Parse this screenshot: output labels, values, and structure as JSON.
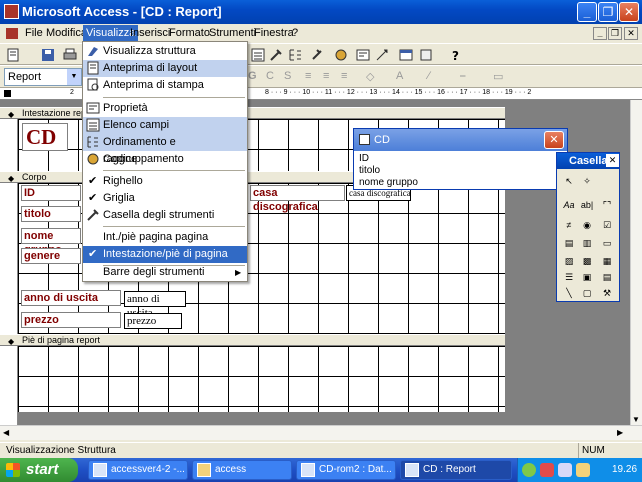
{
  "window": {
    "title": "Microsoft Access - [CD : Report]"
  },
  "menubar": {
    "items": [
      "File",
      "Modifica",
      "Visualizza",
      "Inserisci",
      "Formato",
      "Strumenti",
      "Finestra",
      "?"
    ],
    "active": "Visualizza"
  },
  "toolbar2": {
    "object_combo": "Report"
  },
  "view_menu": {
    "items": [
      {
        "label": "Visualizza struttura",
        "icon": "design-view-icon"
      },
      {
        "label": "Anteprima di layout",
        "icon": "layout-preview-icon"
      },
      {
        "label": "Anteprima di stampa",
        "icon": "print-preview-icon"
      },
      {
        "label": "Proprietà",
        "icon": "properties-icon"
      },
      {
        "label": "Elenco campi",
        "icon": "field-list-icon"
      },
      {
        "label": "Ordinamento e raggruppamento",
        "icon": "sorting-grouping-icon"
      },
      {
        "label": "Codice",
        "icon": "code-icon"
      },
      {
        "label": "Righello",
        "checked": true
      },
      {
        "label": "Griglia",
        "checked": true
      },
      {
        "label": "Casella degli strumenti",
        "icon": "toolbox-icon"
      },
      {
        "label": "Int./piè pagina pagina"
      },
      {
        "label": "Intestazione/piè di pagina report",
        "checked": true,
        "highlighted": true
      },
      {
        "label": "Barre degli strumenti",
        "submenu": true
      }
    ]
  },
  "report": {
    "sections": {
      "header": "Intestazione report",
      "detail": "Corpo",
      "footer": "Piè di pagina report"
    },
    "title_label": "CD",
    "labels": [
      "ID",
      "titolo",
      "nome gruppo",
      "genere",
      "anno di uscita",
      "prezzo",
      "casa discografica"
    ],
    "fields": [
      "anno di uscita",
      "prezzo",
      "casa discografica"
    ]
  },
  "field_list": {
    "title": "CD",
    "fields": [
      "ID",
      "titolo",
      "nome gruppo"
    ]
  },
  "toolbox": {
    "title": "Casella"
  },
  "statusbar": {
    "text": "Visualizzazione Struttura",
    "num": "NUM"
  },
  "taskbar": {
    "start": "start",
    "tasks": [
      "accessver4-2 -...",
      "access",
      "CD-rom2 : Dat...",
      "CD : Report"
    ],
    "clock": "19.26"
  }
}
